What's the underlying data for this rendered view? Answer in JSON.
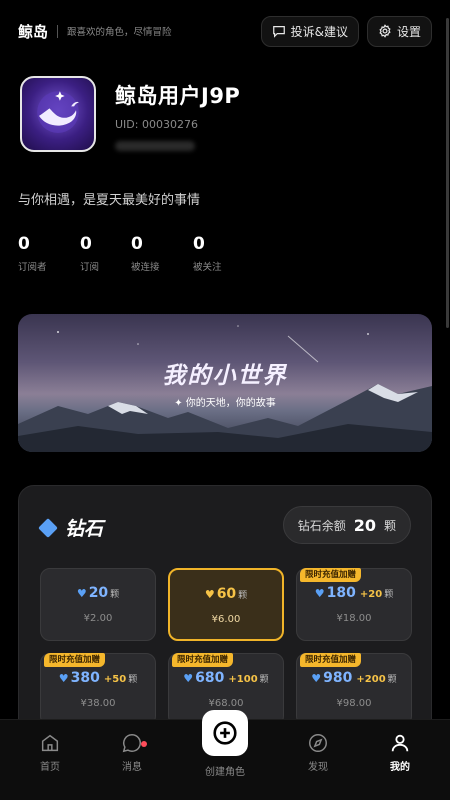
{
  "topbar": {
    "brand": "鲸岛",
    "tagline": "跟喜欢的角色，尽情冒险",
    "feedback_label": "投诉&建议",
    "settings_label": "设置"
  },
  "profile": {
    "name": "鲸岛用户J9P",
    "uid": "UID: 00030276",
    "bio": "与你相遇，是夏天最美好的事情"
  },
  "stats": [
    {
      "value": "0",
      "label": "订阅者"
    },
    {
      "value": "0",
      "label": "订阅"
    },
    {
      "value": "0",
      "label": "被连接"
    },
    {
      "value": "0",
      "label": "被关注"
    }
  ],
  "banner": {
    "title": "我的小世界",
    "subtitle": "✦ 你的天地，你的故事"
  },
  "diamonds": {
    "title": "钻石",
    "balance_label": "钻石余额",
    "balance_value": "20",
    "balance_unit": "颗",
    "packages": [
      {
        "amount": "20",
        "unit": "颗",
        "bonus": "",
        "price": "¥2.00",
        "tag": "",
        "selected": false
      },
      {
        "amount": "60",
        "unit": "颗",
        "bonus": "",
        "price": "¥6.00",
        "tag": "",
        "selected": true
      },
      {
        "amount": "180",
        "unit": "颗",
        "bonus": "+20",
        "price": "¥18.00",
        "tag": "限时充值加赠",
        "selected": false
      },
      {
        "amount": "380",
        "unit": "颗",
        "bonus": "+50",
        "price": "¥38.00",
        "tag": "限时充值加赠",
        "selected": false
      },
      {
        "amount": "680",
        "unit": "颗",
        "bonus": "+100",
        "price": "¥68.00",
        "tag": "限时充值加赠",
        "selected": false
      },
      {
        "amount": "980",
        "unit": "颗",
        "bonus": "+200",
        "price": "¥98.00",
        "tag": "限时充值加赠",
        "selected": false
      }
    ]
  },
  "tabbar": {
    "home": "首页",
    "messages": "消息",
    "create": "创建角色",
    "discover": "发现",
    "mine": "我的"
  },
  "colors": {
    "accent_gold": "#f0b429",
    "diamond_blue": "#5aa0f5",
    "notification_red": "#ff4d5b"
  }
}
